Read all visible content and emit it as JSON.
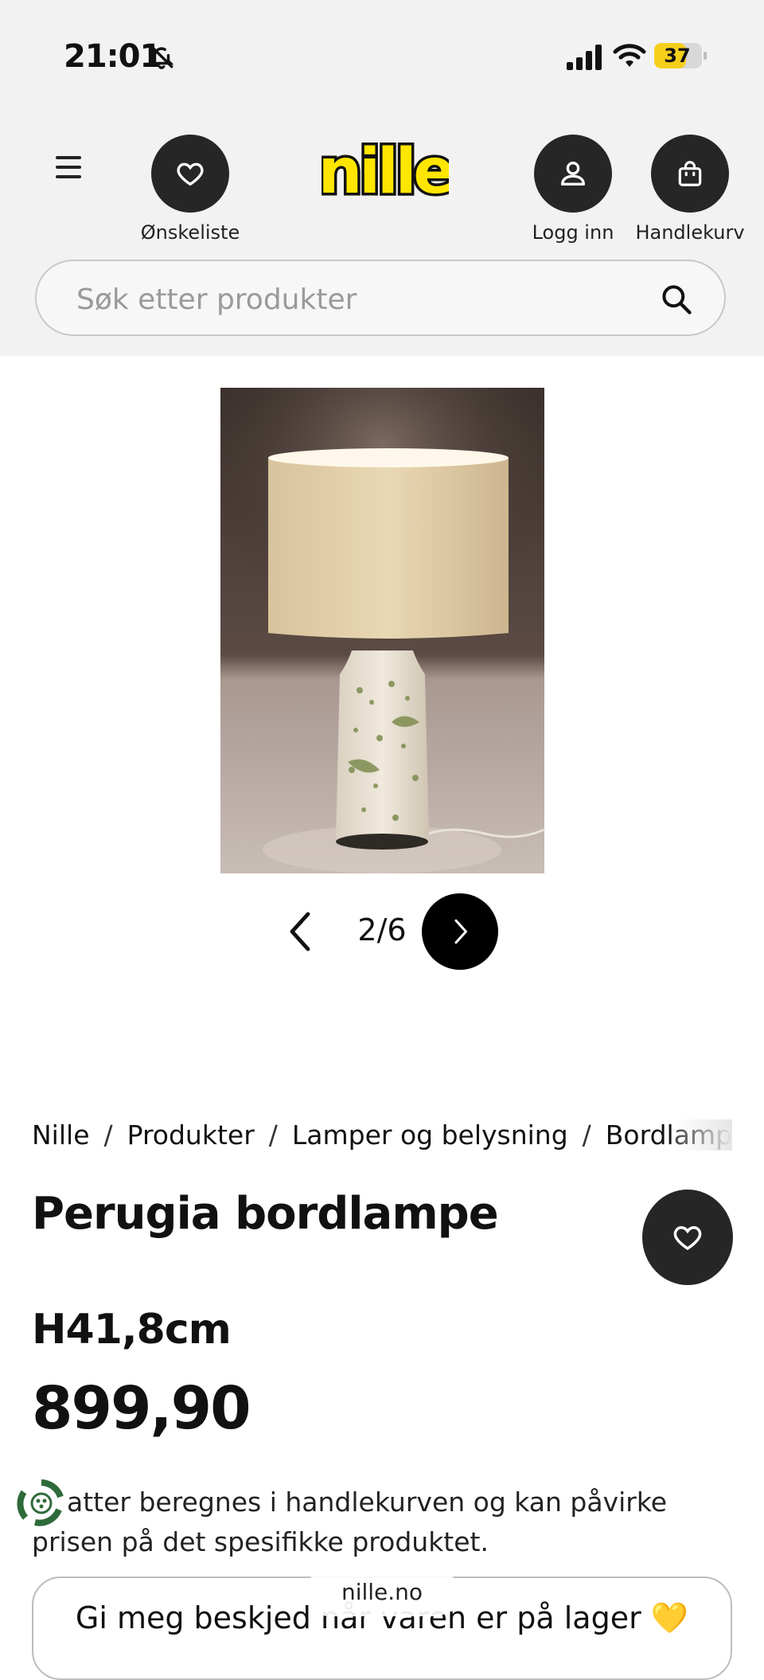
{
  "status_bar": {
    "time": "21:01",
    "battery_level": "37",
    "icons": [
      "bell-slash-icon",
      "signal-icon",
      "wifi-icon",
      "battery-icon"
    ]
  },
  "header": {
    "menu_icon": "hamburger-icon",
    "wishlist_label": "Ønskeliste",
    "logo_text": "nille",
    "login_label": "Logg inn",
    "cart_label": "Handlekurv",
    "brand_color": "#ffe600"
  },
  "search": {
    "placeholder": "Søk etter produkter"
  },
  "gallery": {
    "pager": "2/6"
  },
  "breadcrumb": [
    "Nille",
    "Produkter",
    "Lamper og belysning",
    "Bordlamper"
  ],
  "product": {
    "title": "Perugia bordlampe",
    "size": "H41,8cm",
    "price": "899,90",
    "info_text": "atter beregnes i handlekurven og kan påvirke prisen på det spesifikke produktet.",
    "notify_button": "Gi meg beskjed når varen er på lager 💛"
  },
  "browser": {
    "url": "nille.no"
  }
}
